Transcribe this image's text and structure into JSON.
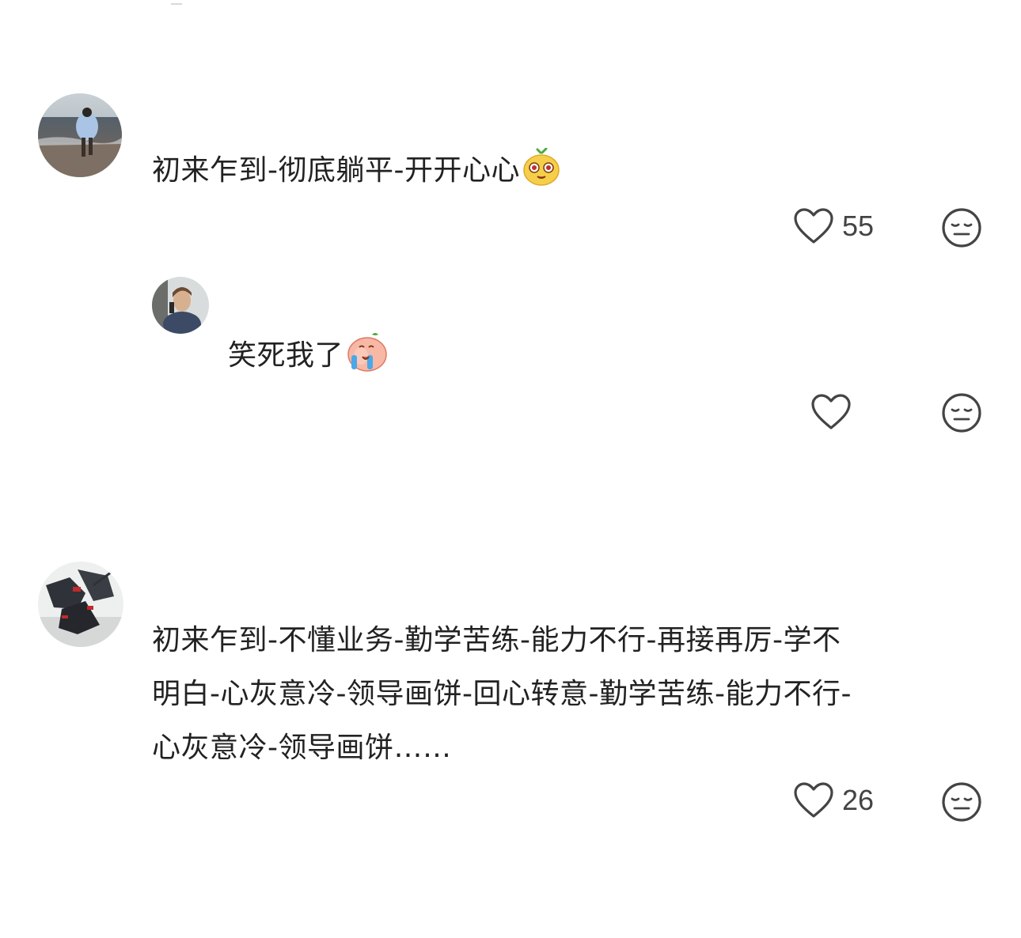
{
  "comments": [
    {
      "text": "初来乍到-彻底躺平-开开心心",
      "emoji": "yellow-cat-face-emoji",
      "like_count": "55",
      "replies": [
        {
          "text": "笑死我了",
          "emoji": "crying-laughing-peach-emoji",
          "like_count": ""
        }
      ]
    },
    {
      "lines": [
        "初来乍到-不懂业务-勤学苦练-能力不行-再接再厉-学不",
        "明白-心灰意冷-领导画饼-回心转意-勤学苦练-能力不行-",
        "心灰意冷-领导画饼……"
      ],
      "like_count": "26"
    }
  ],
  "icons": {
    "like": "heart-outline-icon",
    "dislike": "expressionless-face-icon"
  },
  "colors": {
    "text": "#222222",
    "icon": "#444444"
  }
}
